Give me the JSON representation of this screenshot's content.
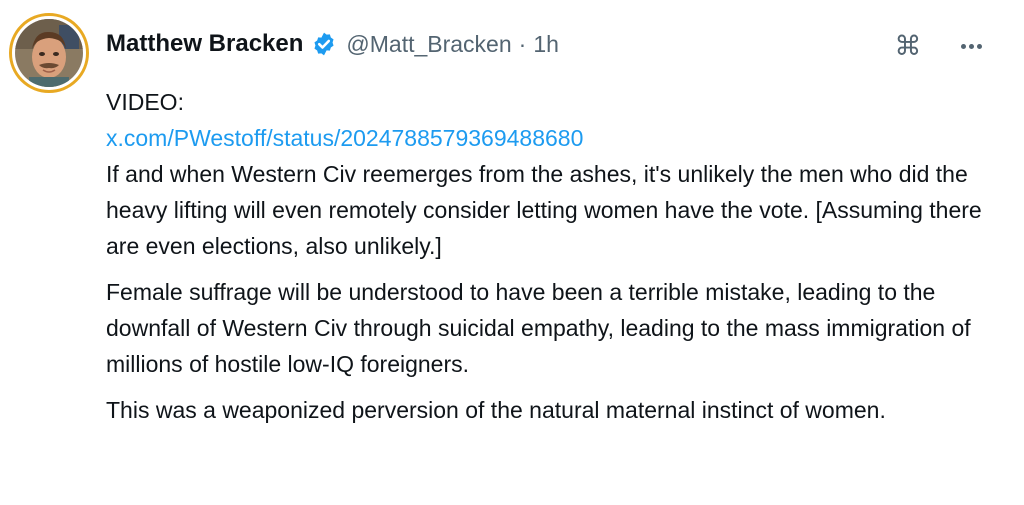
{
  "author": {
    "name": "Matthew Bracken",
    "handle": "@Matt_Bracken",
    "separator": "·",
    "time": "1h",
    "verified": true,
    "avatar_icon": "profile-photo"
  },
  "actions": {
    "grok_icon": "command-icon",
    "more_icon": "more-icon"
  },
  "post": {
    "lines": {
      "video_label": "VIDEO:",
      "link": "x.com/PWestoff/status/2024788579369488680",
      "p1": "If and when Western Civ reemerges from the ashes, it's unlikely the men who did the heavy lifting will even remotely consider letting women have the vote. [Assuming there are even elections, also unlikely.]",
      "p2": "Female suffrage will be understood to have been a terrible mistake, leading to the downfall of Western Civ through suicidal empathy, leading to the mass immigration of millions of hostile low-IQ foreigners.",
      "p3": "This was a weaponized perversion of the natural maternal instinct of women."
    }
  },
  "colors": {
    "text": "#0f1419",
    "secondary": "#536471",
    "link": "#1d9bf0",
    "verified_badge": "#1d9bf0",
    "avatar_ring": "#e8a923"
  }
}
